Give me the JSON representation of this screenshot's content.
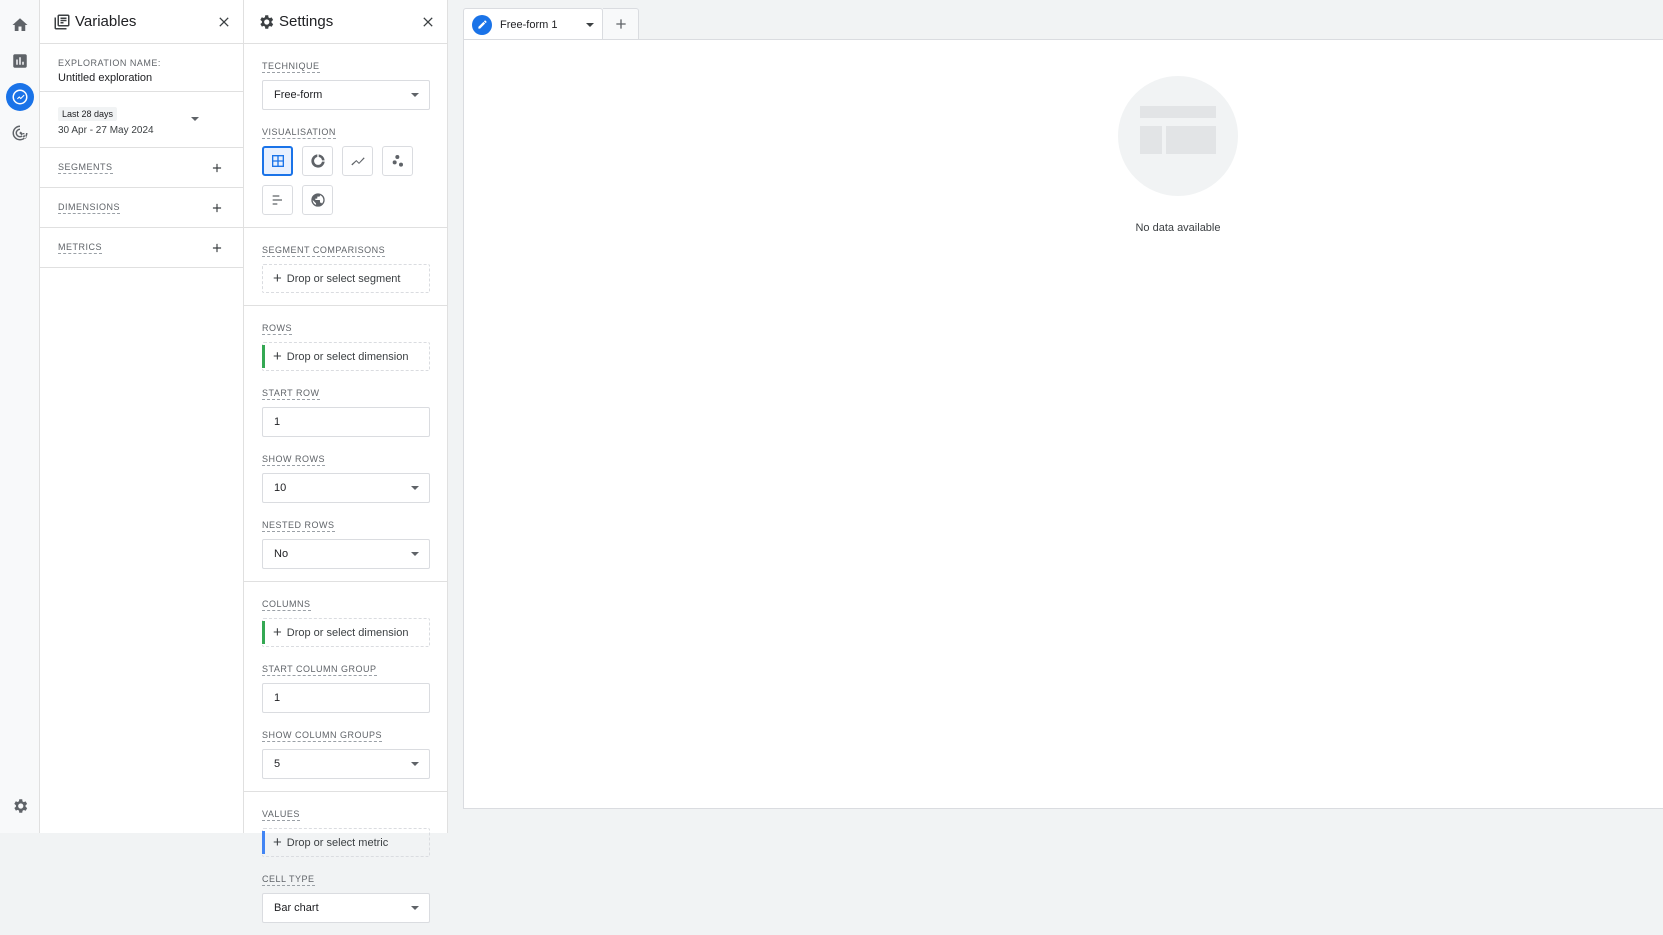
{
  "nav": {
    "items": [
      {
        "icon": "home-icon"
      },
      {
        "icon": "reports-icon"
      },
      {
        "icon": "explore-icon",
        "active": true
      },
      {
        "icon": "advertising-icon"
      }
    ],
    "settings_icon": "gear-icon"
  },
  "variables": {
    "title": "Variables",
    "exploration_name_label": "EXPLORATION NAME:",
    "exploration_name_value": "Untitled exploration",
    "date_chip": "Last 28 days",
    "date_range": "30 Apr - 27 May 2024",
    "segments_label": "SEGMENTS",
    "dimensions_label": "DIMENSIONS",
    "metrics_label": "METRICS"
  },
  "settings": {
    "title": "Settings",
    "technique_label": "TECHNIQUE",
    "technique_value": "Free-form",
    "visualisation_label": "VISUALISATION",
    "segment_comparisons_label": "SEGMENT COMPARISONS",
    "segment_drop": "Drop or select segment",
    "rows_label": "ROWS",
    "rows_drop": "Drop or select dimension",
    "start_row_label": "START ROW",
    "start_row_value": "1",
    "show_rows_label": "SHOW ROWS",
    "show_rows_value": "10",
    "nested_rows_label": "NESTED ROWS",
    "nested_rows_value": "No",
    "columns_label": "COLUMNS",
    "columns_drop": "Drop or select dimension",
    "start_col_group_label": "START COLUMN GROUP",
    "start_col_group_value": "1",
    "show_col_groups_label": "SHOW COLUMN GROUPS",
    "show_col_groups_value": "5",
    "values_label": "VALUES",
    "values_drop": "Drop or select metric",
    "cell_type_label": "CELL TYPE",
    "cell_type_value": "Bar chart"
  },
  "tabs": {
    "active_label": "Free-form 1"
  },
  "canvas": {
    "empty_message": "No data available"
  },
  "colors": {
    "accent": "#1a73e8",
    "rows_bar": "#34a853",
    "values_bar": "#4285f4"
  }
}
